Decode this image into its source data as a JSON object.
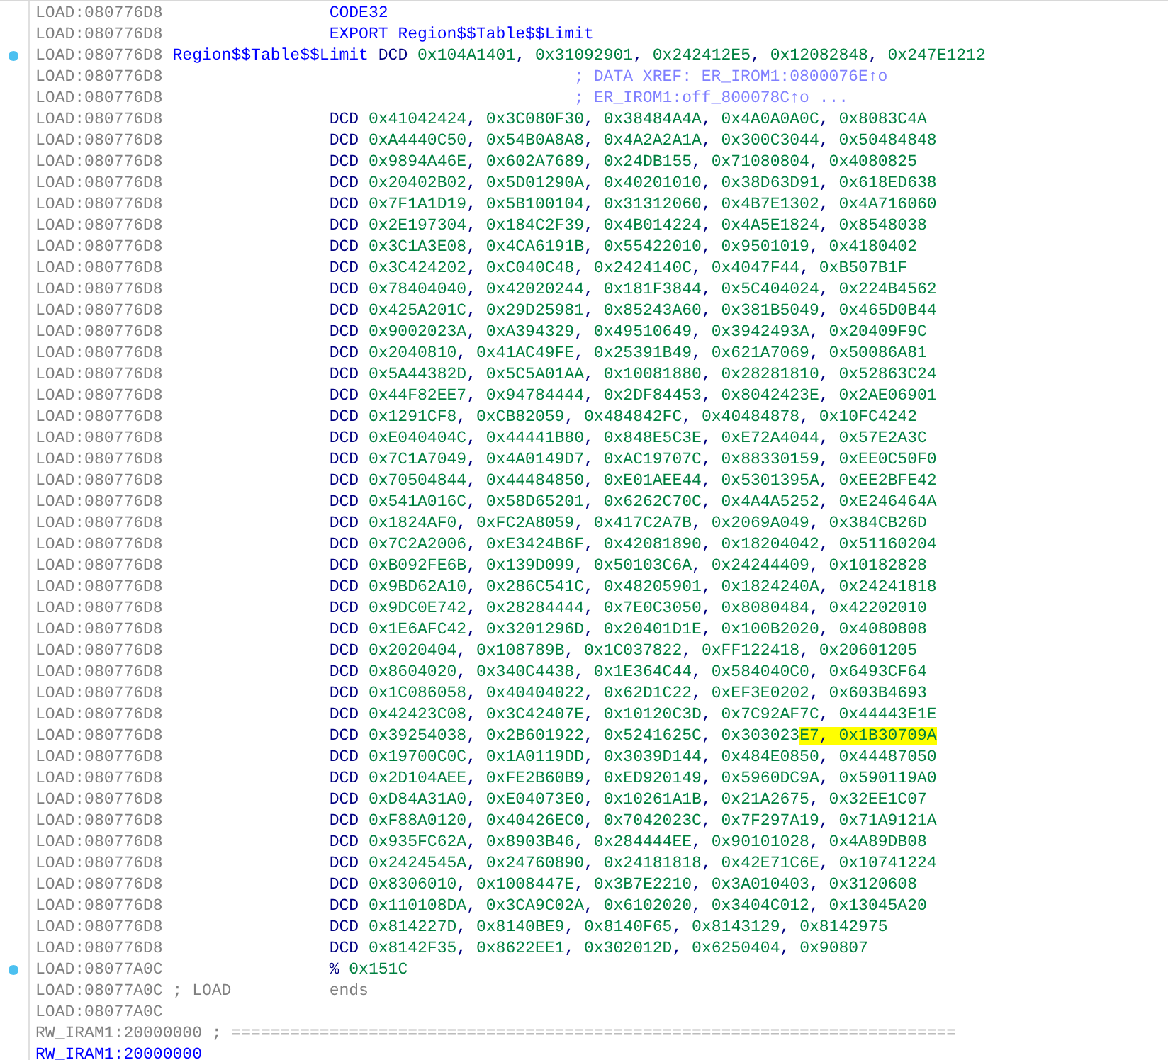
{
  "listing": {
    "lines": [
      {
        "kind": "directive",
        "address": "LOAD:080776D8",
        "op": "CODE32",
        "marked": false
      },
      {
        "kind": "directive",
        "address": "LOAD:080776D8",
        "op": "EXPORT",
        "operands": [
          {
            "text": "Region$$Table$$Limit",
            "highlighted": false
          }
        ],
        "marked": false
      },
      {
        "kind": "data",
        "address": "LOAD:080776D8",
        "label": "Region$$Table$$Limit",
        "op": "DCD",
        "operands": [
          {
            "text": "0x104A1401, 0x31092901, 0x242412E5, 0x12082848, 0x247E1212",
            "highlighted": false
          }
        ],
        "marked": true
      },
      {
        "kind": "xref",
        "address": "LOAD:080776D8",
        "comment": "; DATA XREF: ER_IROM1:0800076E↑o",
        "marked": false
      },
      {
        "kind": "xref",
        "address": "LOAD:080776D8",
        "comment": "; ER_IROM1:off_800078C↑o ...",
        "marked": false
      },
      {
        "kind": "data",
        "address": "LOAD:080776D8",
        "op": "DCD",
        "operands": [
          {
            "text": "0x41042424, 0x3C080F30, 0x38484A4A, 0x4A0A0A0C, 0x8083C4A",
            "highlighted": false
          }
        ],
        "marked": false
      },
      {
        "kind": "data",
        "address": "LOAD:080776D8",
        "op": "DCD",
        "operands": [
          {
            "text": "0xA4440C50, 0x54B0A8A8, 0x4A2A2A1A, 0x300C3044, 0x50484848",
            "highlighted": false
          }
        ],
        "marked": false
      },
      {
        "kind": "data",
        "address": "LOAD:080776D8",
        "op": "DCD",
        "operands": [
          {
            "text": "0x9894A46E, 0x602A7689, 0x24DB155, 0x71080804, 0x4080825",
            "highlighted": false
          }
        ],
        "marked": false
      },
      {
        "kind": "data",
        "address": "LOAD:080776D8",
        "op": "DCD",
        "operands": [
          {
            "text": "0x20402B02, 0x5D01290A, 0x40201010, 0x38D63D91, 0x618ED638",
            "highlighted": false
          }
        ],
        "marked": false
      },
      {
        "kind": "data",
        "address": "LOAD:080776D8",
        "op": "DCD",
        "operands": [
          {
            "text": "0x7F1A1D19, 0x5B100104, 0x31312060, 0x4B7E1302, 0x4A716060",
            "highlighted": false
          }
        ],
        "marked": false
      },
      {
        "kind": "data",
        "address": "LOAD:080776D8",
        "op": "DCD",
        "operands": [
          {
            "text": "0x2E197304, 0x184C2F39, 0x4B014224, 0x4A5E1824, 0x8548038",
            "highlighted": false
          }
        ],
        "marked": false
      },
      {
        "kind": "data",
        "address": "LOAD:080776D8",
        "op": "DCD",
        "operands": [
          {
            "text": "0x3C1A3E08, 0x4CA6191B, 0x55422010, 0x9501019, 0x4180402",
            "highlighted": false
          }
        ],
        "marked": false
      },
      {
        "kind": "data",
        "address": "LOAD:080776D8",
        "op": "DCD",
        "operands": [
          {
            "text": "0x3C424202, 0xC040C48, 0x2424140C, 0x4047F44, 0xB507B1F",
            "highlighted": false
          }
        ],
        "marked": false
      },
      {
        "kind": "data",
        "address": "LOAD:080776D8",
        "op": "DCD",
        "operands": [
          {
            "text": "0x78404040, 0x42020244, 0x181F3844, 0x5C404024, 0x224B4562",
            "highlighted": false
          }
        ],
        "marked": false
      },
      {
        "kind": "data",
        "address": "LOAD:080776D8",
        "op": "DCD",
        "operands": [
          {
            "text": "0x425A201C, 0x29D25981, 0x85243A60, 0x381B5049, 0x465D0B44",
            "highlighted": false
          }
        ],
        "marked": false
      },
      {
        "kind": "data",
        "address": "LOAD:080776D8",
        "op": "DCD",
        "operands": [
          {
            "text": "0x9002023A, 0xA394329, 0x49510649, 0x3942493A, 0x20409F9C",
            "highlighted": false
          }
        ],
        "marked": false
      },
      {
        "kind": "data",
        "address": "LOAD:080776D8",
        "op": "DCD",
        "operands": [
          {
            "text": "0x2040810, 0x41AC49FE, 0x25391B49, 0x621A7069, 0x50086A81",
            "highlighted": false
          }
        ],
        "marked": false
      },
      {
        "kind": "data",
        "address": "LOAD:080776D8",
        "op": "DCD",
        "operands": [
          {
            "text": "0x5A44382D, 0x5C5A01AA, 0x10081880, 0x28281810, 0x52863C24",
            "highlighted": false
          }
        ],
        "marked": false
      },
      {
        "kind": "data",
        "address": "LOAD:080776D8",
        "op": "DCD",
        "operands": [
          {
            "text": "0x44F82EE7, 0x94784444, 0x2DF84453, 0x8042423E, 0x2AE06901",
            "highlighted": false
          }
        ],
        "marked": false
      },
      {
        "kind": "data",
        "address": "LOAD:080776D8",
        "op": "DCD",
        "operands": [
          {
            "text": "0x1291CF8, 0xCB82059, 0x484842FC, 0x40484878, 0x10FC4242",
            "highlighted": false
          }
        ],
        "marked": false
      },
      {
        "kind": "data",
        "address": "LOAD:080776D8",
        "op": "DCD",
        "operands": [
          {
            "text": "0xE040404C, 0x44441B80, 0x848E5C3E, 0xE72A4044, 0x57E2A3C",
            "highlighted": false
          }
        ],
        "marked": false
      },
      {
        "kind": "data",
        "address": "LOAD:080776D8",
        "op": "DCD",
        "operands": [
          {
            "text": "0x7C1A7049, 0x4A0149D7, 0xAC19707C, 0x88330159, 0xEE0C50F0",
            "highlighted": false
          }
        ],
        "marked": false
      },
      {
        "kind": "data",
        "address": "LOAD:080776D8",
        "op": "DCD",
        "operands": [
          {
            "text": "0x70504844, 0x44484850, 0xE01AEE44, 0x5301395A, 0xEE2BFE42",
            "highlighted": false
          }
        ],
        "marked": false
      },
      {
        "kind": "data",
        "address": "LOAD:080776D8",
        "op": "DCD",
        "operands": [
          {
            "text": "0x541A016C, 0x58D65201, 0x6262C70C, 0x4A4A5252, 0xE246464A",
            "highlighted": false
          }
        ],
        "marked": false
      },
      {
        "kind": "data",
        "address": "LOAD:080776D8",
        "op": "DCD",
        "operands": [
          {
            "text": "0x1824AF0, 0xFC2A8059, 0x417C2A7B, 0x2069A049, 0x384CB26D",
            "highlighted": false
          }
        ],
        "marked": false
      },
      {
        "kind": "data",
        "address": "LOAD:080776D8",
        "op": "DCD",
        "operands": [
          {
            "text": "0x7C2A2006, 0xE3424B6F, 0x42081890, 0x18204042, 0x51160204",
            "highlighted": false
          }
        ],
        "marked": false
      },
      {
        "kind": "data",
        "address": "LOAD:080776D8",
        "op": "DCD",
        "operands": [
          {
            "text": "0xB092FE6B, 0x139D099, 0x50103C6A, 0x24244409, 0x10182828",
            "highlighted": false
          }
        ],
        "marked": false
      },
      {
        "kind": "data",
        "address": "LOAD:080776D8",
        "op": "DCD",
        "operands": [
          {
            "text": "0x9BD62A10, 0x286C541C, 0x48205901, 0x1824240A, 0x24241818",
            "highlighted": false
          }
        ],
        "marked": false
      },
      {
        "kind": "data",
        "address": "LOAD:080776D8",
        "op": "DCD",
        "operands": [
          {
            "text": "0x9DC0E742, 0x28284444, 0x7E0C3050, 0x8080484, 0x42202010",
            "highlighted": false
          }
        ],
        "marked": false
      },
      {
        "kind": "data",
        "address": "LOAD:080776D8",
        "op": "DCD",
        "operands": [
          {
            "text": "0x1E6AFC42, 0x3201296D, 0x20401D1E, 0x100B2020, 0x4080808",
            "highlighted": false
          }
        ],
        "marked": false
      },
      {
        "kind": "data",
        "address": "LOAD:080776D8",
        "op": "DCD",
        "operands": [
          {
            "text": "0x2020404, 0x108789B, 0x1C037822, 0xFF122418, 0x20601205",
            "highlighted": false
          }
        ],
        "marked": false
      },
      {
        "kind": "data",
        "address": "LOAD:080776D8",
        "op": "DCD",
        "operands": [
          {
            "text": "0x8604020, 0x340C4438, 0x1E364C44, 0x584040C0, 0x6493CF64",
            "highlighted": false
          }
        ],
        "marked": false
      },
      {
        "kind": "data",
        "address": "LOAD:080776D8",
        "op": "DCD",
        "operands": [
          {
            "text": "0x1C086058, 0x40404022, 0x62D1C22, 0xEF3E0202, 0x603B4693",
            "highlighted": false
          }
        ],
        "marked": false
      },
      {
        "kind": "data",
        "address": "LOAD:080776D8",
        "op": "DCD",
        "operands": [
          {
            "text": "0x42423C08, 0x3C42407E, 0x10120C3D, 0x7C92AF7C, 0x44443E1E",
            "highlighted": false
          }
        ],
        "marked": false
      },
      {
        "kind": "data",
        "address": "LOAD:080776D8",
        "op": "DCD",
        "operands": [
          {
            "text": "0x39254038, 0x2B601922, 0x5241625C, 0x303023",
            "highlighted": false
          },
          {
            "text": "E7, 0x1B30709A",
            "highlighted": true
          }
        ],
        "marked": false
      },
      {
        "kind": "data",
        "address": "LOAD:080776D8",
        "op": "DCD",
        "operands": [
          {
            "text": "0x19700C0C, 0x1A0119DD, 0x3039D144, 0x484E0850, 0x44487050",
            "highlighted": false
          }
        ],
        "marked": false
      },
      {
        "kind": "data",
        "address": "LOAD:080776D8",
        "op": "DCD",
        "operands": [
          {
            "text": "0x2D104AEE, 0xFE2B60B9, 0xED920149, 0x5960DC9A, 0x590119A0",
            "highlighted": false
          }
        ],
        "marked": false
      },
      {
        "kind": "data",
        "address": "LOAD:080776D8",
        "op": "DCD",
        "operands": [
          {
            "text": "0xD84A31A0, 0xE04073E0, 0x10261A1B, 0x21A2675, 0x32EE1C07",
            "highlighted": false
          }
        ],
        "marked": false
      },
      {
        "kind": "data",
        "address": "LOAD:080776D8",
        "op": "DCD",
        "operands": [
          {
            "text": "0xF88A0120, 0x40426EC0, 0x7042023C, 0x7F297A19, 0x71A9121A",
            "highlighted": false
          }
        ],
        "marked": false
      },
      {
        "kind": "data",
        "address": "LOAD:080776D8",
        "op": "DCD",
        "operands": [
          {
            "text": "0x935FC62A, 0x8903B46, 0x284444EE, 0x90101028, 0x4A89DB08",
            "highlighted": false
          }
        ],
        "marked": false
      },
      {
        "kind": "data",
        "address": "LOAD:080776D8",
        "op": "DCD",
        "operands": [
          {
            "text": "0x2424545A, 0x24760890, 0x24181818, 0x42E71C6E, 0x10741224",
            "highlighted": false
          }
        ],
        "marked": false
      },
      {
        "kind": "data",
        "address": "LOAD:080776D8",
        "op": "DCD",
        "operands": [
          {
            "text": "0x8306010, 0x1008447E, 0x3B7E2210, 0x3A010403, 0x3120608",
            "highlighted": false
          }
        ],
        "marked": false
      },
      {
        "kind": "data",
        "address": "LOAD:080776D8",
        "op": "DCD",
        "operands": [
          {
            "text": "0x110108DA, 0x3CA9C02A, 0x6102020, 0x3404C012, 0x13045A20",
            "highlighted": false
          }
        ],
        "marked": false
      },
      {
        "kind": "data",
        "address": "LOAD:080776D8",
        "op": "DCD",
        "operands": [
          {
            "text": "0x814227D, 0x8140BE9, 0x8140F65, 0x8143129, 0x8142975",
            "highlighted": false
          }
        ],
        "marked": false
      },
      {
        "kind": "data",
        "address": "LOAD:080776D8",
        "op": "DCD",
        "operands": [
          {
            "text": "0x8142F35, 0x8622EE1, 0x302012D, 0x6250404, 0x90807",
            "highlighted": false
          }
        ],
        "marked": false
      },
      {
        "kind": "data",
        "address": "LOAD:08077A0C",
        "op": "%",
        "operands": [
          {
            "text": "0x151C",
            "highlighted": false
          }
        ],
        "marked": true
      },
      {
        "kind": "end",
        "address": "LOAD:08077A0C",
        "note": "; LOAD",
        "op": "ends",
        "marked": false
      },
      {
        "kind": "blank",
        "address": "LOAD:08077A0C",
        "marked": false
      },
      {
        "kind": "separator",
        "address": "RW_IRAM1:20000000",
        "comment": "; ==========================================================================",
        "marked": false
      },
      {
        "kind": "segment",
        "address": "RW_IRAM1:20000000",
        "marked": false
      }
    ]
  }
}
